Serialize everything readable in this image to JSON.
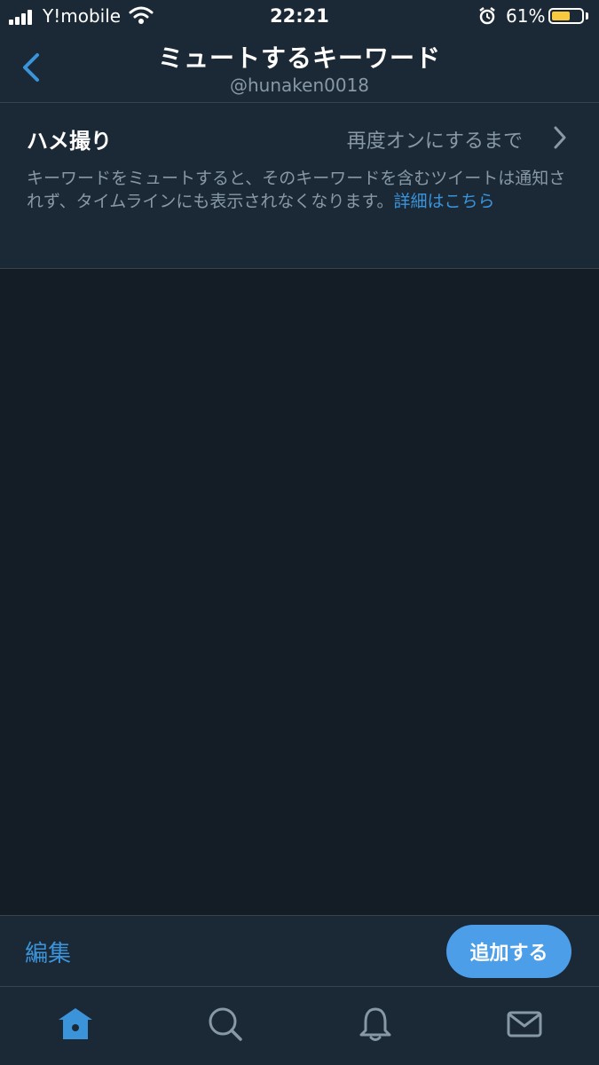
{
  "status_bar": {
    "carrier": "Y!mobile",
    "time": "22:21",
    "battery_percent": "61%",
    "battery_level": 0.61,
    "icons": [
      "signal-icon",
      "wifi-icon",
      "alarm-icon",
      "battery-icon"
    ]
  },
  "nav": {
    "title": "ミュートするキーワード",
    "subtitle": "@hunaken0018"
  },
  "keyword": {
    "name": "ハメ撮り",
    "duration": "再度オンにするまで"
  },
  "description": {
    "text": "キーワードをミュートすると、そのキーワードを含むツイートは通知されず、タイムラインにも表示されなくなります。",
    "link": "詳細はこちら"
  },
  "toolbar": {
    "edit_label": "編集",
    "add_label": "追加する"
  },
  "tabs": [
    "home-icon",
    "search-icon",
    "notifications-icon",
    "messages-icon"
  ],
  "colors": {
    "background": "#141d26",
    "surface": "#1b2836",
    "accent": "#3b94d9",
    "secondary_text": "#8899a6",
    "battery": "#f8c93f"
  }
}
